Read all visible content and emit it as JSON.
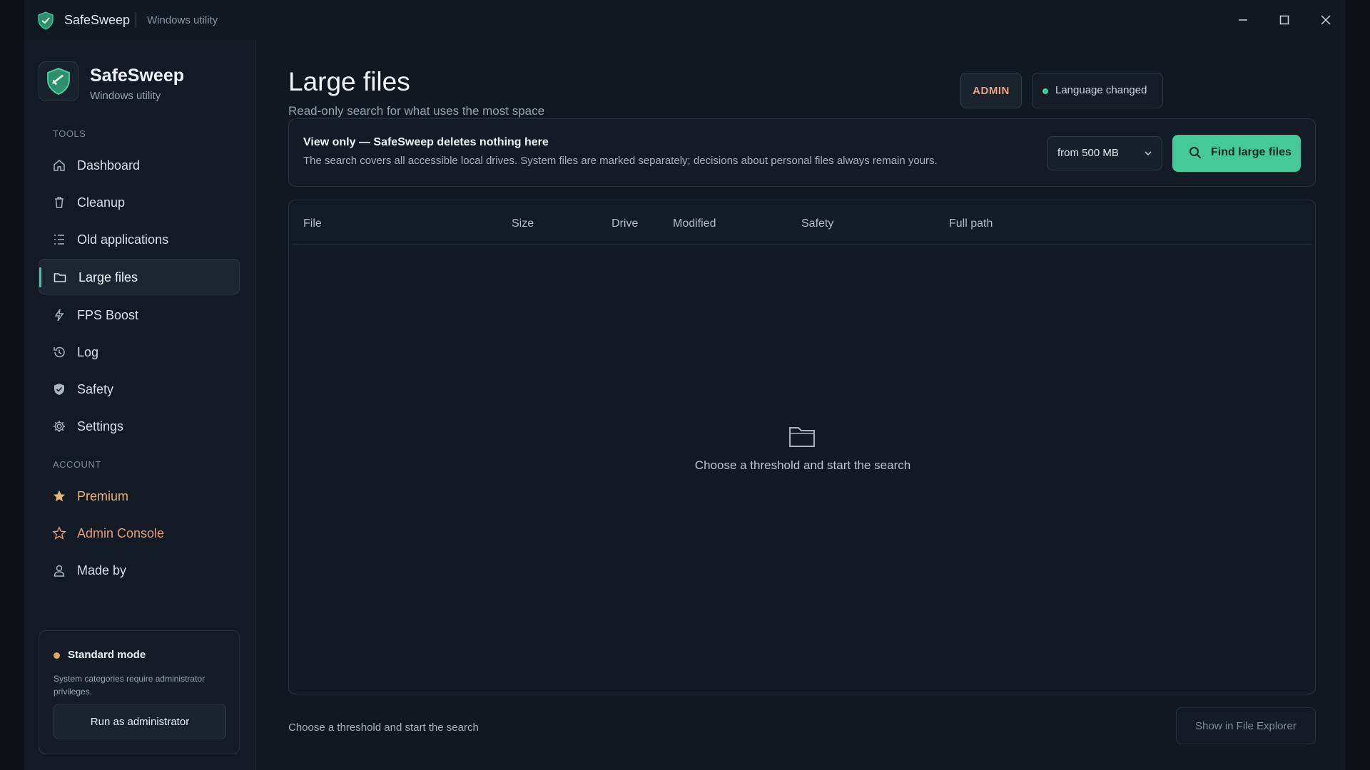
{
  "titlebar": {
    "app_name": "SafeSweep",
    "subtitle": "Windows utility"
  },
  "sidebar": {
    "brand_name": "SafeSweep",
    "brand_sub": "Windows utility",
    "tools_label": "TOOLS",
    "account_label": "ACCOUNT",
    "tools": [
      {
        "label": "Dashboard",
        "icon": "home-icon"
      },
      {
        "label": "Cleanup",
        "icon": "trash-icon"
      },
      {
        "label": "Old applications",
        "icon": "list-icon"
      },
      {
        "label": "Large files",
        "icon": "folder-icon",
        "active": true
      },
      {
        "label": "FPS Boost",
        "icon": "bolt-icon"
      },
      {
        "label": "Log",
        "icon": "history-icon"
      },
      {
        "label": "Safety",
        "icon": "shield-icon"
      },
      {
        "label": "Settings",
        "icon": "gear-icon"
      }
    ],
    "account": [
      {
        "label": "Premium",
        "icon": "star-filled-icon"
      },
      {
        "label": "Admin Console",
        "icon": "star-outline-icon"
      },
      {
        "label": "Made by",
        "icon": "user-icon"
      }
    ],
    "mode_card": {
      "title": "Standard mode",
      "description": "System categories require administrator privileges.",
      "button_label": "Run as administrator"
    }
  },
  "main": {
    "title": "Large files",
    "subtitle": "Read-only search for what uses the most space",
    "admin_badge": "ADMIN",
    "status_text": "Language changed",
    "info": {
      "title": "View only — SafeSweep deletes nothing here",
      "text": "The search covers all accessible local drives. System files are marked separately; decisions about personal files always remain yours.",
      "threshold_value": "from 500 MB",
      "find_button": "Find large files"
    },
    "table": {
      "columns": [
        "File",
        "Size",
        "Drive",
        "Modified",
        "Safety",
        "Full path"
      ],
      "empty_text": "Choose a threshold and start the search"
    },
    "footer_text": "Choose a threshold and start the search",
    "explorer_button": "Show in File Explorer"
  },
  "colors": {
    "accent": "#46c99a",
    "premium": "#e5b577",
    "admin": "#e09d80",
    "warning_dot": "#e0a85b"
  }
}
